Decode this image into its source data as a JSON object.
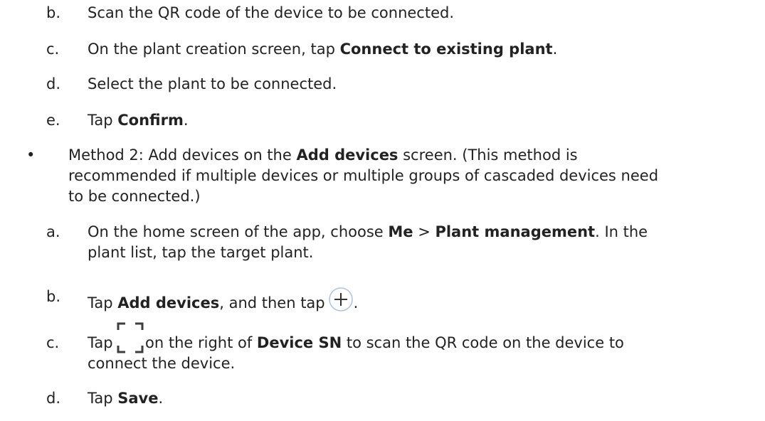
{
  "steps_top": {
    "b": {
      "marker": "b.",
      "text": "Scan the QR code of the device to be connected."
    },
    "c": {
      "marker": "c.",
      "pre": "On the plant creation screen, tap ",
      "bold": "Connect to existing plant",
      "post": "."
    },
    "d": {
      "marker": "d.",
      "text": "Select the plant to be connected."
    },
    "e": {
      "marker": "e.",
      "pre": "Tap ",
      "bold": "Confirm",
      "post": "."
    }
  },
  "method2": {
    "bullet": "•",
    "pre": "Method 2: Add devices on the ",
    "bold": "Add devices",
    "post1": " screen. (This method is",
    "line2": "recommended if multiple devices or multiple groups of cascaded devices need",
    "line3": "to be connected.)"
  },
  "method2_steps": {
    "a": {
      "marker": "a.",
      "pre": "On the home screen of the app, choose ",
      "bold1": "Me",
      "sep": " > ",
      "bold2": "Plant management",
      "post": ". In the",
      "line2": "plant list, tap the target plant."
    },
    "b": {
      "marker": "b.",
      "pre": "Tap ",
      "bold": "Add devices",
      "post": ", and then tap",
      "end": "."
    },
    "c": {
      "marker": "c.",
      "pre": "Tap",
      "mid": " on the right of ",
      "bold": "Device SN",
      "post": " to scan the QR code on the device to",
      "line2": "connect the device."
    },
    "d": {
      "marker": "d.",
      "pre": "Tap ",
      "bold": "Save",
      "post": "."
    }
  },
  "icons": {
    "add": "plus-circle-icon",
    "scan": "scan-frame-icon"
  },
  "colors": {
    "text": "#222222",
    "icon_stroke": "#3a7bd5"
  }
}
